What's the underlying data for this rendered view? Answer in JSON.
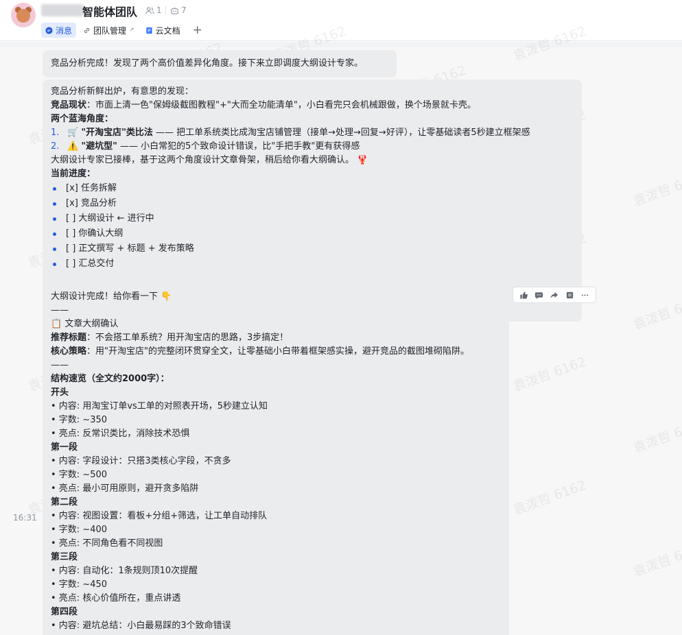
{
  "header": {
    "title": "智能体团队",
    "members_count": "1",
    "bots_count": "7",
    "tabs": [
      {
        "label": "消息"
      },
      {
        "label": "团队管理"
      },
      {
        "label": "云文档"
      }
    ],
    "add_tab_label": "+"
  },
  "messages": {
    "msg1": "竞品分析完成！发现了两个高价值差异化角度。接下来立即调度大纲设计专家。",
    "msg2": {
      "intro": "竞品分析新鲜出炉，有意思的发现：",
      "status_label": "竞品现状",
      "status_text": "：市面上清一色\"保姆级截图教程\"+\"大而全功能清单\"，小白看完只会机械跟做，换个场景就卡壳。",
      "angles_label": "两个蓝海角度：",
      "angle1_num": "1.",
      "angle1_icon": "🛒",
      "angle1_title": "\"开淘宝店\"类比法",
      "angle1_text": " —— 把工单系统类比成淘宝店铺管理（接单→处理→回复→好评），让零基础读者5秒建立框架感",
      "angle2_num": "2.",
      "angle2_icon": "⚠️",
      "angle2_title": "\"避坑型\"",
      "angle2_text": " —— 小白常犯的5个致命设计错误，比\"手把手教\"更有获得感",
      "handoff": "大纲设计专家已接棒，基于这两个角度设计文章骨架，稍后给你看大纲确认。",
      "handoff_icon": "🦞",
      "progress_label": "当前进度：",
      "progress": [
        "[x] 任务拆解",
        "[x] 竞品分析",
        "[ ] 大纲设计 ← 进行中",
        "[ ] 你确认大纲",
        "[ ] 正文撰写 + 标题 + 发布策略",
        "[ ] 汇总交付"
      ]
    },
    "msg3": {
      "intro": "大纲设计完成！给你看一下 👇",
      "divider": "——",
      "doc_title": "📋 文章大纲确认",
      "rec_label": "推荐标题",
      "rec_text": "：不会搭工单系统？用开淘宝店的思路，3步搞定！",
      "core_label": "核心策略",
      "core_text": "：用\"开淘宝店\"的完整闭环贯穿全文，让零基础小白带着框架感实操，避开竞品的截图堆砌陷阱。",
      "divider2": "——",
      "overview": "结构速览（全文约2000字）：",
      "sections": [
        {
          "name": "开头",
          "items": [
            "• 内容: 用淘宝订单vs工单的对照表开场，5秒建立认知",
            "• 字数: ~350",
            "• 亮点: 反常识类比，消除技术恐惧"
          ]
        },
        {
          "name": "第一段",
          "items": [
            "• 内容: 字段设计：只搭3类核心字段，不贪多",
            "• 字数: ~500",
            "• 亮点: 最小可用原则，避开贪多陷阱"
          ]
        },
        {
          "name": "第二段",
          "items": [
            "• 内容: 视图设置：看板+分组+筛选，让工单自动排队",
            "• 字数: ~400",
            "• 亮点: 不同角色看不同视图"
          ]
        },
        {
          "name": "第三段",
          "items": [
            "• 内容: 自动化：1条规则顶10次提醒",
            "• 字数: ~450",
            "• 亮点: 核心价值所在，重点讲透"
          ]
        },
        {
          "name": "第四段",
          "items": [
            "• 内容: 避坑总结：小白最易踩的3个致命错误"
          ]
        }
      ]
    }
  },
  "timestamp": "16:31",
  "watermark": "袁泼哲 6162",
  "icons": {
    "members": "members-icon",
    "bot": "bot-icon",
    "message": "message-icon",
    "link": "link-icon",
    "doc": "doc-icon",
    "thumb": "thumb-up-icon",
    "reply": "reply-icon",
    "forward": "forward-icon",
    "pin": "pin-icon",
    "more": "more-icon"
  },
  "colors": {
    "accent": "#245bdb",
    "bubble": "#ebecee",
    "tab_active_bg": "#e1eaff"
  }
}
